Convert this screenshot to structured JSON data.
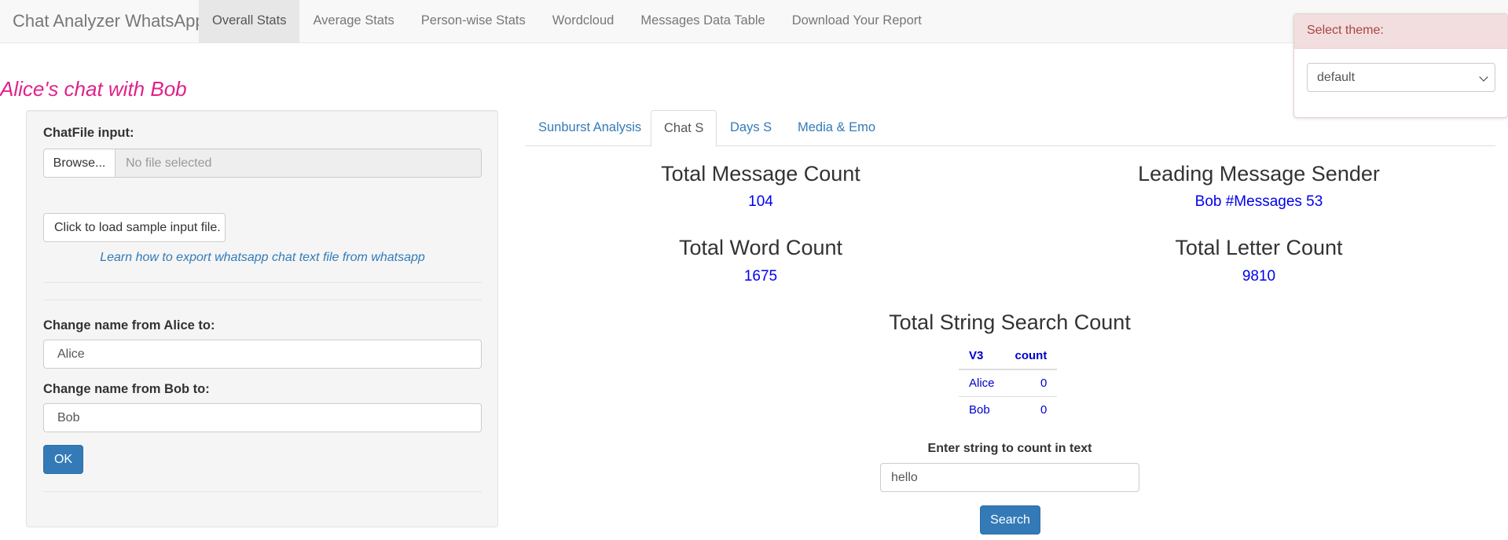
{
  "navbar": {
    "brand": "Chat Analyzer WhatsApp",
    "items": [
      {
        "label": "Overall Stats",
        "active": true
      },
      {
        "label": "Average Stats",
        "active": false
      },
      {
        "label": "Person-wise Stats",
        "active": false
      },
      {
        "label": "Wordcloud",
        "active": false
      },
      {
        "label": "Messages Data Table",
        "active": false
      },
      {
        "label": "Download Your Report",
        "active": false
      }
    ]
  },
  "page": {
    "title": "Alice's chat with Bob"
  },
  "sidebar": {
    "file_label": "ChatFile input:",
    "browse_label": "Browse...",
    "file_placeholder": "No file selected",
    "sample_button": "Click to load sample input file.",
    "export_link": "Learn how to export whatsapp chat text file from whatsapp",
    "rename_alice_label": "Change name from Alice to:",
    "rename_alice_value": "Alice",
    "rename_bob_label": "Change name from Bob to:",
    "rename_bob_value": "Bob",
    "ok_label": "OK"
  },
  "tabs": [
    {
      "label": "Sunburst Analysis",
      "active": false
    },
    {
      "label": "Chat S",
      "active": true
    },
    {
      "label": "Days S",
      "active": false
    },
    {
      "label": "Media & Emo",
      "active": false
    }
  ],
  "stats": {
    "total_message_title": "Total Message Count",
    "total_message_value": "104",
    "leading_sender_title": "Leading Message Sender",
    "leading_sender_value": "Bob #Messages 53",
    "total_word_title": "Total Word Count",
    "total_word_value": "1675",
    "total_letter_title": "Total Letter Count",
    "total_letter_value": "9810",
    "string_search_title": "Total String Search Count"
  },
  "search_table": {
    "headers": [
      "V3",
      "count"
    ],
    "rows": [
      [
        "Alice",
        "0"
      ],
      [
        "Bob",
        "0"
      ]
    ]
  },
  "search": {
    "label": "Enter string to count in text",
    "value": "hello",
    "button": "Search"
  },
  "theme": {
    "label": "Select theme:",
    "selected": "default"
  },
  "colors": {
    "title_accent": "#e0218a",
    "stat_value": "#0000ee",
    "primary_button": "#337ab7",
    "theme_header_bg": "#f2dede",
    "theme_header_text": "#a94442"
  }
}
